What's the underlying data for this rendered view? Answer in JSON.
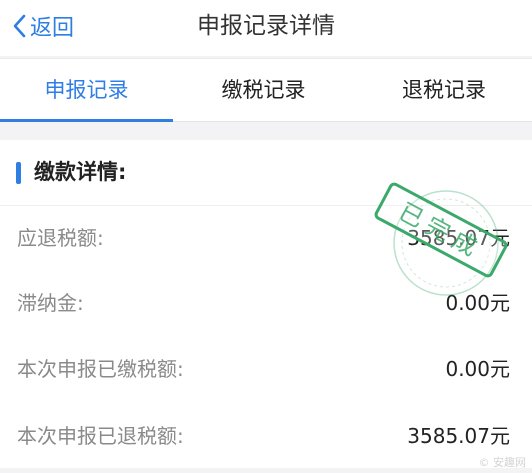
{
  "header": {
    "back_label": "返回",
    "title": "申报记录详情"
  },
  "tabs": [
    {
      "label": "申报记录",
      "active": true
    },
    {
      "label": "缴税记录",
      "active": false
    },
    {
      "label": "退税记录",
      "active": false
    }
  ],
  "section": {
    "title": "缴款详情:"
  },
  "rows": [
    {
      "label": "应退税额:",
      "value": "3585.07元"
    },
    {
      "label": "滞纳金:",
      "value": "0.00元"
    },
    {
      "label": "本次申报已缴税额:",
      "value": "0.00元"
    },
    {
      "label": "本次申报已退税额:",
      "value": "3585.07元"
    }
  ],
  "stamp": {
    "text": "已完成"
  },
  "watermark": {
    "text": "© 安趣网"
  },
  "colors": {
    "accent": "#2f7ee4",
    "stamp": "#3aa96a",
    "label": "#8a8a8a",
    "value": "#222222"
  }
}
